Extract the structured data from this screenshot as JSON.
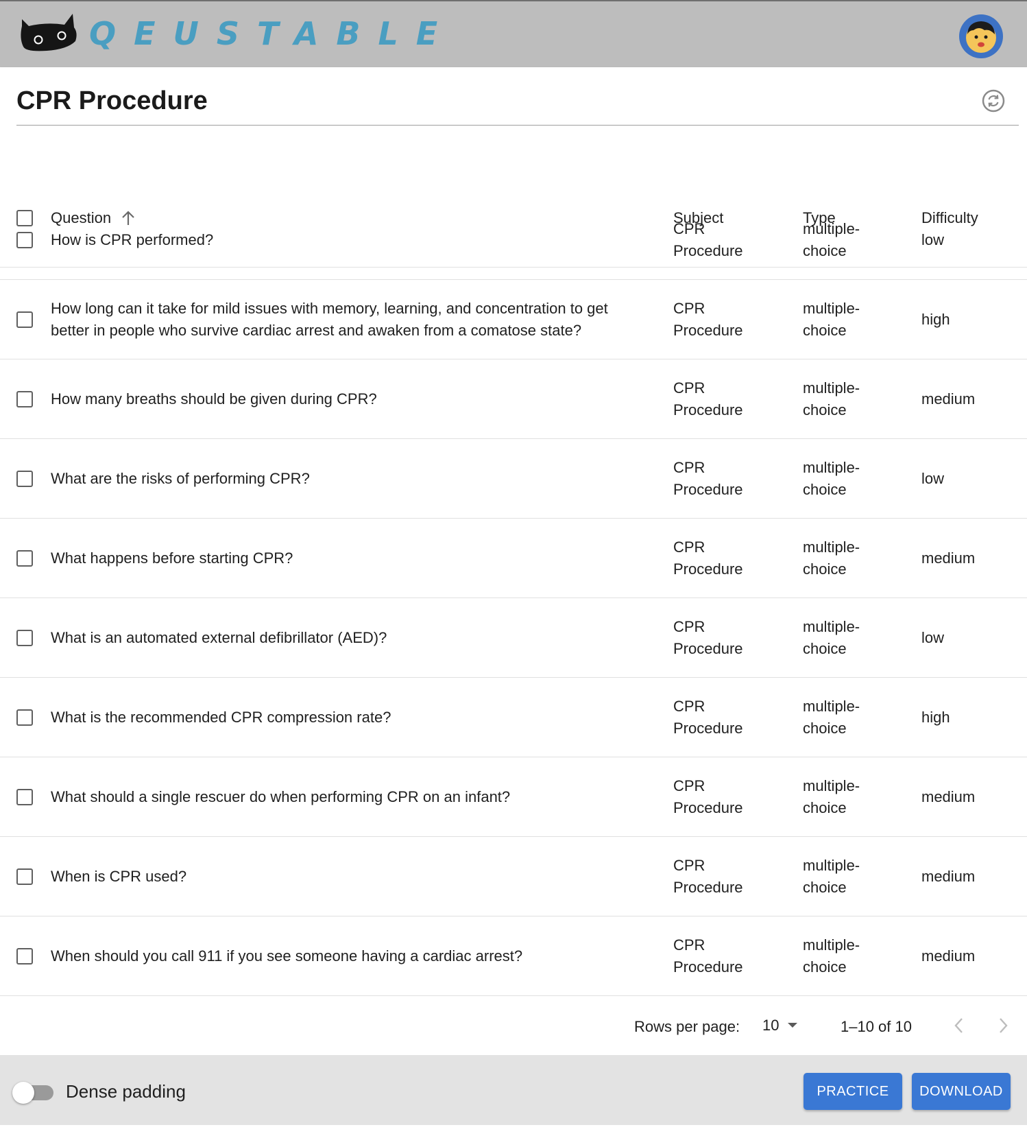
{
  "app": {
    "logo_text": "QEUSTABLE",
    "accent_color": "#4a9ec1",
    "header_color": "#bdbdbd"
  },
  "page": {
    "title": "CPR Procedure"
  },
  "table": {
    "headers": {
      "question": "Question",
      "subject": "Subject",
      "type": "Type",
      "difficulty": "Difficulty"
    },
    "sort_direction": "ascending",
    "rows": [
      {
        "question": "How is CPR performed?",
        "subject": [
          "CPR",
          "Procedure"
        ],
        "type": [
          "multiple-",
          "choice"
        ],
        "difficulty": "low"
      },
      {
        "question": [
          "How long can it take for mild issues with memory, learning, and concentration to get",
          "better in people who survive cardiac arrest and awaken from a comatose state?"
        ],
        "subject": [
          "CPR",
          "Procedure"
        ],
        "type": [
          "multiple-",
          "choice"
        ],
        "difficulty": "high"
      },
      {
        "question": "How many breaths should be given during CPR?",
        "subject": [
          "CPR",
          "Procedure"
        ],
        "type": [
          "multiple-",
          "choice"
        ],
        "difficulty": "medium"
      },
      {
        "question": "What are the risks of performing CPR?",
        "subject": [
          "CPR",
          "Procedure"
        ],
        "type": [
          "multiple-",
          "choice"
        ],
        "difficulty": "low"
      },
      {
        "question": "What happens before starting CPR?",
        "subject": [
          "CPR",
          "Procedure"
        ],
        "type": [
          "multiple-",
          "choice"
        ],
        "difficulty": "medium"
      },
      {
        "question": "What is an automated external defibrillator (AED)?",
        "subject": [
          "CPR",
          "Procedure"
        ],
        "type": [
          "multiple-",
          "choice"
        ],
        "difficulty": "low"
      },
      {
        "question": "What is the recommended CPR compression rate?",
        "subject": [
          "CPR",
          "Procedure"
        ],
        "type": [
          "multiple-",
          "choice"
        ],
        "difficulty": "high"
      },
      {
        "question": "What should a single rescuer do when performing CPR on an infant?",
        "subject": [
          "CPR",
          "Procedure"
        ],
        "type": [
          "multiple-",
          "choice"
        ],
        "difficulty": "medium"
      },
      {
        "question": "When is CPR used?",
        "subject": [
          "CPR",
          "Procedure"
        ],
        "type": [
          "multiple-",
          "choice"
        ],
        "difficulty": "medium"
      },
      {
        "question": "When should you call 911 if you see someone having a cardiac arrest?",
        "subject": [
          "CPR",
          "Procedure"
        ],
        "type": [
          "multiple-",
          "choice"
        ],
        "difficulty": "medium"
      }
    ]
  },
  "pagination": {
    "rows_per_page_label": "Rows per page:",
    "rows_per_page_value": "10",
    "range_label": "1–10 of 10"
  },
  "footer": {
    "dense_padding_label": "Dense padding",
    "dense_padding_on": false,
    "practice_label": "PRACTICE",
    "download_label": "DOWNLOAD",
    "button_color": "#3a78d4"
  },
  "icons": {
    "logo": "cat-icon",
    "avatar": "user-avatar-icon",
    "refresh": "refresh-icon",
    "sort": "arrow-up-icon",
    "dropdown": "caret-down-icon",
    "prev": "chevron-left-icon",
    "next": "chevron-right-icon"
  }
}
